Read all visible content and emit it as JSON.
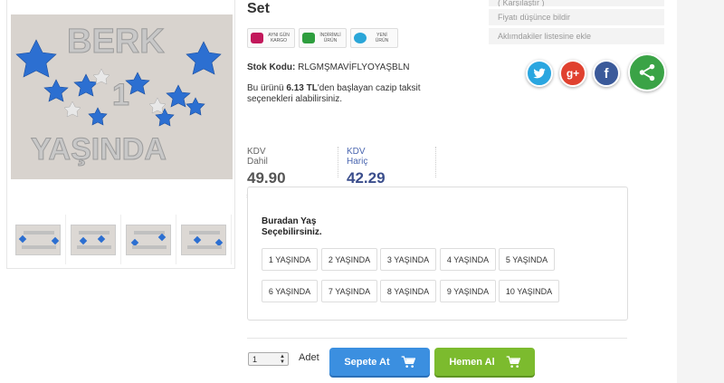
{
  "product": {
    "title_fragment": "Set",
    "stock_label": "Stok Kodu:",
    "stock_code": "RLGMŞMAVİFLYOYAŞBLN",
    "install_pre": "Bu ürünü",
    "install_amount": "6.13 TL",
    "install_post": "'den başlayan cazip taksit seçenekleri alabilirsiniz."
  },
  "badges": [
    {
      "line1": "AYNI GÜN",
      "line2": "KARGO",
      "icon": "truck-icon",
      "color": "#c2185b"
    },
    {
      "line1": "İNDİRİMLİ",
      "line2": "ÜRÜN",
      "icon": "discount-icon",
      "color": "#2e9e3e"
    },
    {
      "line1": "YENİ",
      "line2": "ÜRÜN",
      "icon": "new-icon",
      "color": "#2aa6d8"
    }
  ],
  "side_links": [
    "( Karşılaştır )",
    "Fiyatı düşünce bildir",
    "Aklımdakiler listesine ekle"
  ],
  "social": [
    {
      "icon": "twitter-icon",
      "glyph": "t",
      "color": "#2aa6e0"
    },
    {
      "icon": "google-plus-icon",
      "glyph": "g+",
      "color": "#e0412f"
    },
    {
      "icon": "facebook-icon",
      "glyph": "f",
      "color": "#3b5a9a"
    },
    {
      "icon": "share-icon",
      "glyph": "",
      "color": "#3aa346"
    }
  ],
  "prices": {
    "incl_label": "KDV Dahil",
    "incl_value": "49.90 ₺",
    "excl_label": "KDV Hariç",
    "excl_value": "42.29 ₺",
    "incl_color": "#555555",
    "excl_color": "#3b4e8c"
  },
  "options": {
    "title": "Buradan Yaş Seçebilirsiniz.",
    "items": [
      "1 YAŞINDA",
      "2 YAŞINDA",
      "3 YAŞINDA",
      "4 YAŞINDA",
      "5 YAŞINDA",
      "6 YAŞINDA",
      "7 YAŞINDA",
      "8 YAŞINDA",
      "9 YAŞINDA",
      "10 YAŞINDA"
    ]
  },
  "cart": {
    "quantity": "1",
    "unit_label": "Adet",
    "add_to_cart": "Sepete At",
    "buy_now": "Hemen Al",
    "add_color": "#3b8fe0",
    "buy_color": "#7cbb2e"
  },
  "gallery": {
    "thumb_count": 4,
    "image_text": [
      "BERK",
      "1",
      "YAŞINDA"
    ]
  }
}
